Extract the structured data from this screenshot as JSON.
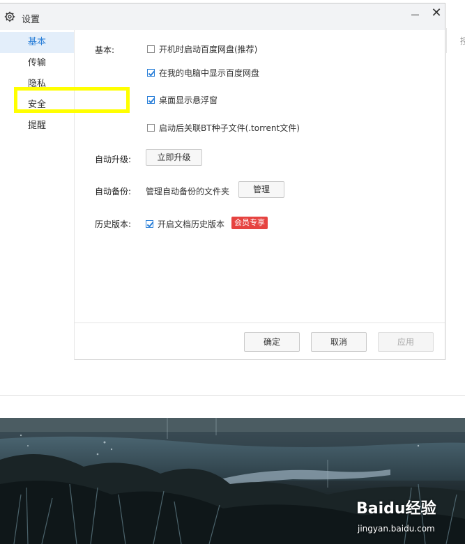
{
  "window": {
    "title": "设置",
    "close_glyph": "✕"
  },
  "background_page": {
    "right_label": "授"
  },
  "sidebar": {
    "items": [
      {
        "label": "基本",
        "active": true
      },
      {
        "label": "传输"
      },
      {
        "label": "隐私"
      },
      {
        "label": "安全"
      },
      {
        "label": "提醒"
      }
    ]
  },
  "basic": {
    "label": "基本:",
    "options": [
      {
        "label": "开机时启动百度网盘(推荐)",
        "checked": false
      },
      {
        "label": "在我的电脑中显示百度网盘",
        "checked": true
      },
      {
        "label": "桌面显示悬浮窗",
        "checked": true
      },
      {
        "label": "启动后关联BT种子文件(.torrent文件)",
        "checked": false
      }
    ]
  },
  "upgrade": {
    "label": "自动升级:",
    "button": "立即升级"
  },
  "backup": {
    "label": "自动备份:",
    "text": "管理自动备份的文件夹",
    "button": "管理"
  },
  "history": {
    "label": "历史版本:",
    "option": "开启文档历史版本",
    "checked": true,
    "badge": "会员专享"
  },
  "footer": {
    "ok": "确定",
    "cancel": "取消",
    "apply": "应用"
  },
  "watermark": {
    "brand": "Baidu经验",
    "url": "jingyan.baidu.com"
  },
  "colors": {
    "accent": "#2a7fd8",
    "highlight": "#ffff00",
    "badge": "#e64340"
  }
}
